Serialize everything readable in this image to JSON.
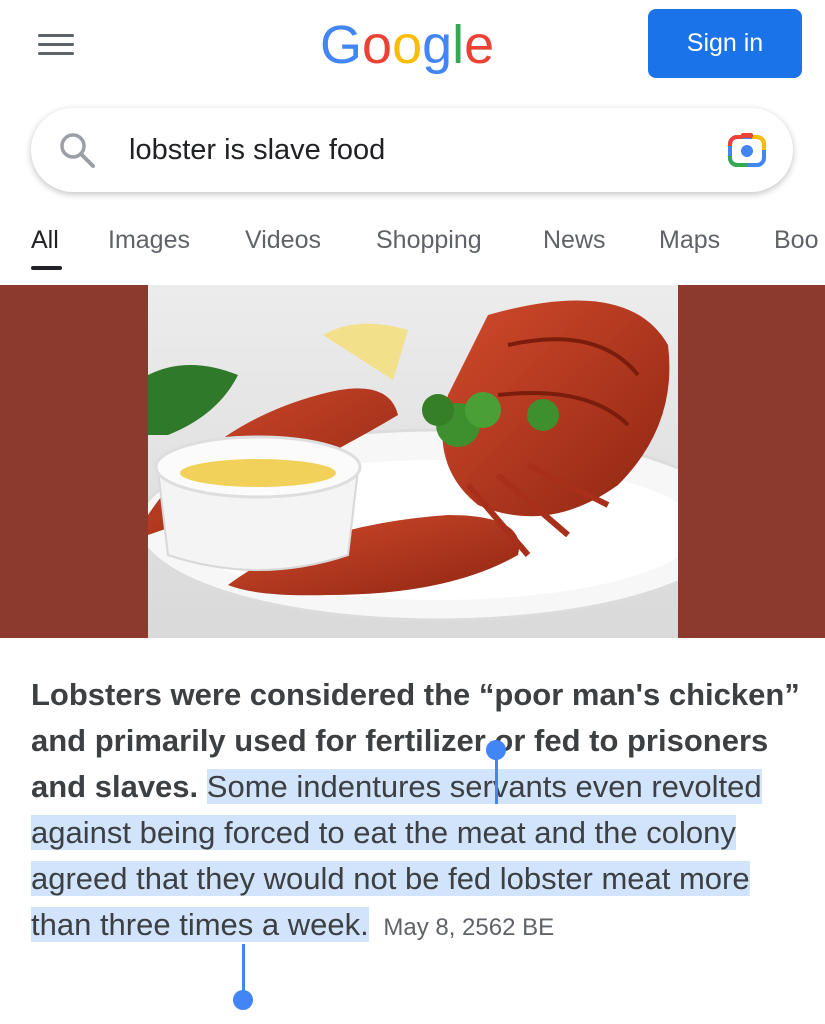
{
  "header": {
    "logo_text": "Google",
    "logo_colors": [
      "#4285F4",
      "#EA4335",
      "#FBBC05",
      "#4285F4",
      "#34A853",
      "#EA4335"
    ],
    "menu_icon": "hamburger-menu-icon",
    "signin_label": "Sign in",
    "signin_color": "#1a73e8"
  },
  "search": {
    "query": "lobster is slave food",
    "search_icon": "search-icon",
    "lens_icon": "google-lens-icon"
  },
  "tabs": [
    {
      "label": "All",
      "active": true
    },
    {
      "label": "Images",
      "active": false
    },
    {
      "label": "Videos",
      "active": false
    },
    {
      "label": "Shopping",
      "active": false
    },
    {
      "label": "News",
      "active": false
    },
    {
      "label": "Maps",
      "active": false
    },
    {
      "label": "Boo",
      "active": false
    }
  ],
  "featured_snippet": {
    "image_description_icon": "lobster-plate-image",
    "panel_color": "#8c3a2d",
    "bold_text": "Lobsters were considered the “poor man's chicken” and primarily used for fertilizer or fed to prisoners and slaves.",
    "highlighted_text": "Some indentures servants even revolted against being forced to eat the meat and the colony agreed that they would not be fed lobster meat more than three times a week.",
    "date": "May 8, 2562 BE",
    "selection_color": "#d2e3fc"
  }
}
